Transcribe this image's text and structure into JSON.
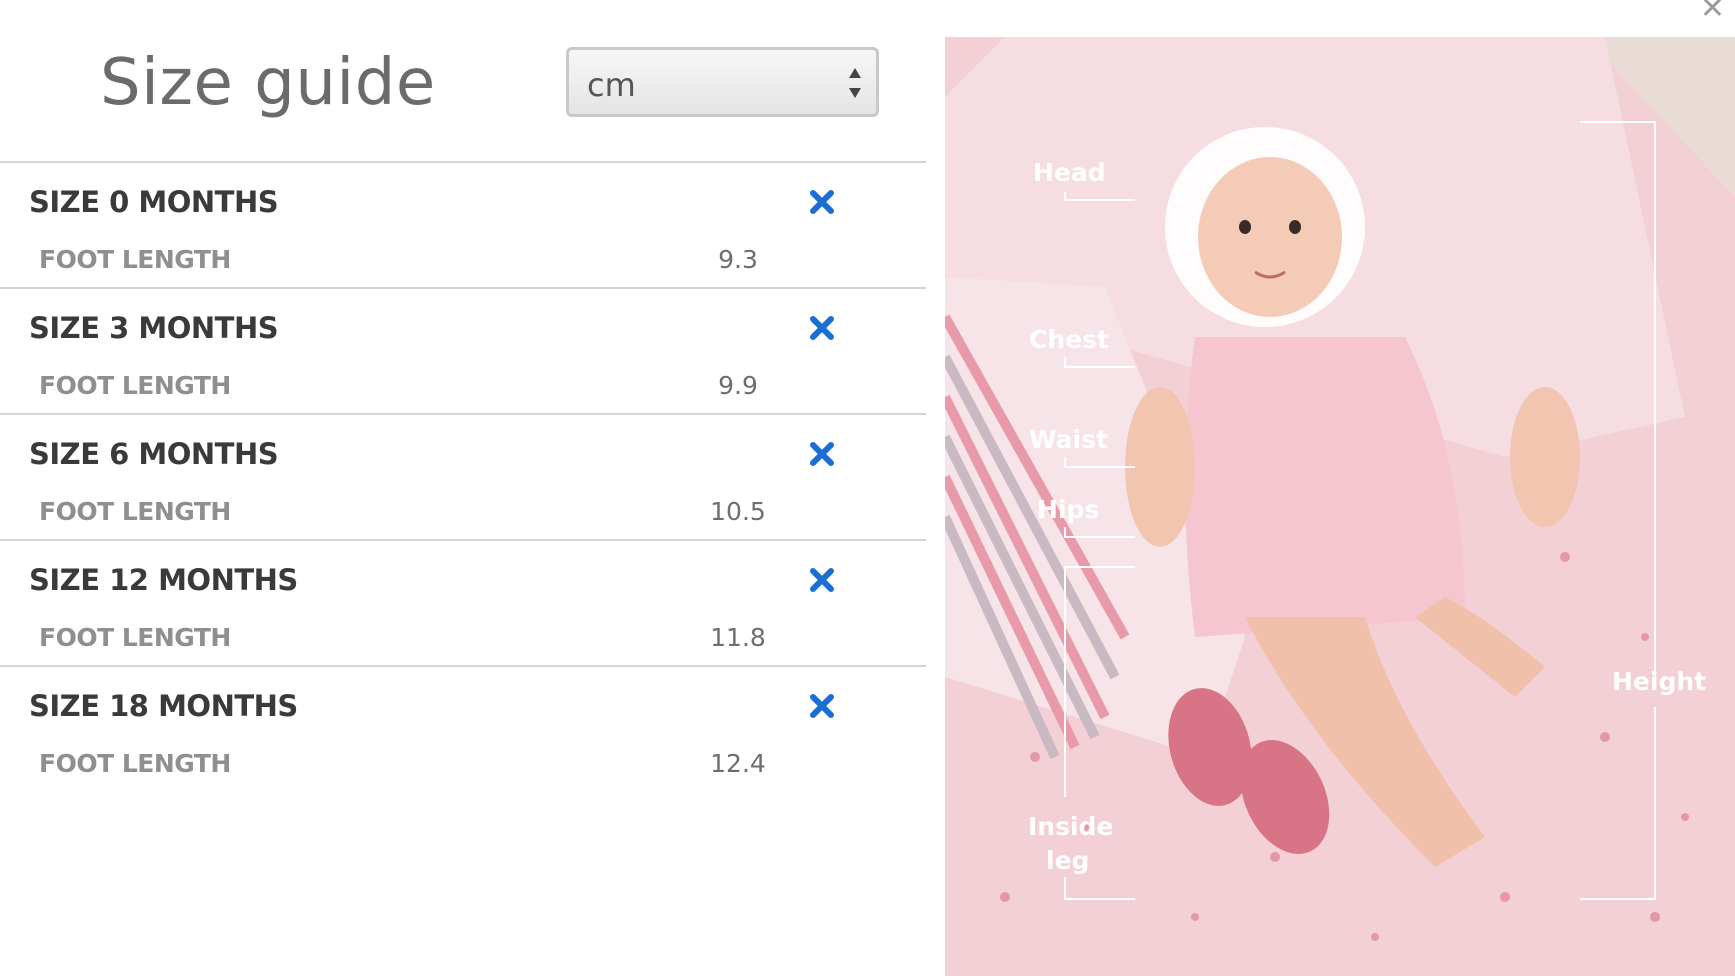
{
  "modal": {
    "close_icon": "close-icon"
  },
  "header": {
    "title": "Size guide",
    "unit_select": {
      "value": "cm",
      "options_icon": "updown-arrows-icon"
    }
  },
  "sizes": [
    {
      "title": "SIZE 0 MONTHS",
      "measurement": "FOOT LENGTH",
      "value": "9.3"
    },
    {
      "title": "SIZE 3 MONTHS",
      "measurement": "FOOT LENGTH",
      "value": "9.9"
    },
    {
      "title": "SIZE 6 MONTHS",
      "measurement": "FOOT LENGTH",
      "value": "10.5"
    },
    {
      "title": "SIZE 12 MONTHS",
      "measurement": "FOOT LENGTH",
      "value": "11.8"
    },
    {
      "title": "SIZE 18 MONTHS",
      "measurement": "FOOT LENGTH",
      "value": "12.4"
    }
  ],
  "photo": {
    "labels": {
      "head": "Head",
      "chest": "Chest",
      "waist": "Waist",
      "hips": "Hips",
      "inside_leg_1": "Inside",
      "inside_leg_2": "leg",
      "height": "Height"
    }
  },
  "colors": {
    "accent": "#1a6fd4",
    "title": "#6b6b6b",
    "divider": "#d4d4d4",
    "photo_pink": "#f0c9cf"
  }
}
